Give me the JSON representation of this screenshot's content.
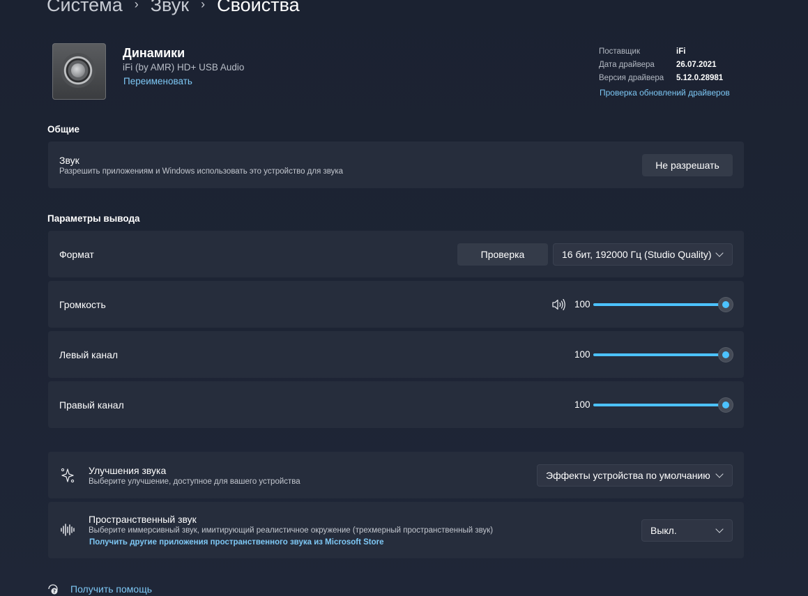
{
  "breadcrumb": [
    "Система",
    "Звук",
    "Свойства"
  ],
  "device": {
    "name": "Динамики",
    "subtitle": "iFi (by AMR) HD+ USB Audio",
    "rename": "Переименовать"
  },
  "driver": {
    "provider_label": "Поставщик",
    "provider": "iFi",
    "date_label": "Дата драйвера",
    "date": "26.07.2021",
    "version_label": "Версия драйвера",
    "version": "5.12.0.28981",
    "update_link": "Проверка обновлений драйверов"
  },
  "general": {
    "heading": "Общие",
    "sound_title": "Звук",
    "sound_sub": "Разрешить приложениям и Windows использовать это устройство для звука",
    "sound_button": "Не разрешать"
  },
  "output": {
    "heading": "Параметры вывода",
    "format_label": "Формат",
    "test_button": "Проверка",
    "format_value": "16 бит, 192000 Гц (Studio Quality)",
    "volume_label": "Громкость",
    "volume_value": "100",
    "left_label": "Левый канал",
    "left_value": "100",
    "right_label": "Правый канал",
    "right_value": "100",
    "levels": {
      "volume": 1.0,
      "left": 1.0,
      "right": 1.0
    }
  },
  "enhancements": {
    "title": "Улучшения звука",
    "sub": "Выберите улучшение, доступное для вашего устройства",
    "value": "Эффекты устройства по умолчанию"
  },
  "spatial": {
    "title": "Пространственный звук",
    "sub": "Выберите иммерсивный звук, имитирующий реалистичное окружение (трехмерный пространственный звук)",
    "link": "Получить другие приложения пространственного звука из Microsoft Store",
    "value": "Выкл."
  },
  "help": "Получить помощь",
  "colors": {
    "accent": "#4cc2ff",
    "link": "#7ec8f5",
    "card": "#262d3c",
    "background": "#1d2433"
  },
  "icons": [
    "chevron-right-icon",
    "speaker-volume-icon",
    "sparkle-icon",
    "spatial-audio-icon",
    "help-icon",
    "chevron-down-icon"
  ]
}
